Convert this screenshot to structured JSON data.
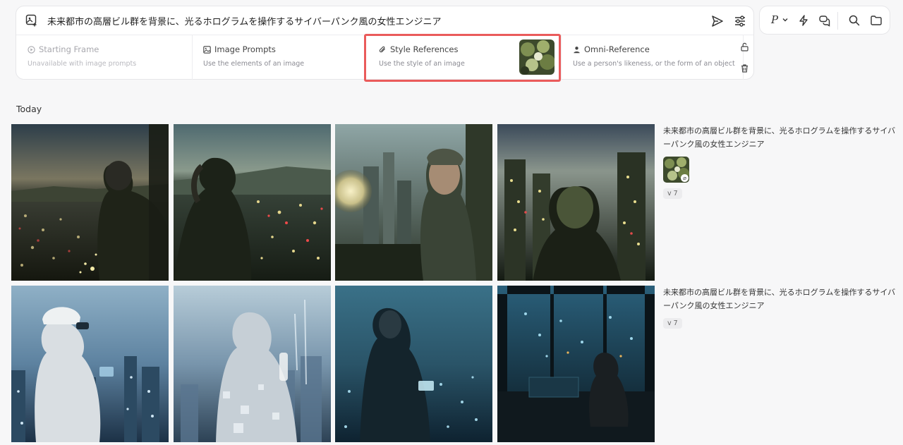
{
  "prompt": {
    "text": "未来都市の高層ビル群を背景に、光るホログラムを操作するサイバーパンク風の女性エンジニア"
  },
  "references": {
    "starting_frame": {
      "title": "Starting Frame",
      "subtitle": "Unavailable with image prompts"
    },
    "image_prompts": {
      "title": "Image Prompts",
      "subtitle": "Use the elements of an image"
    },
    "style_references": {
      "title": "Style References",
      "subtitle": "Use the style of an image"
    },
    "omni_reference": {
      "title": "Omni-Reference",
      "subtitle": "Use a person's likeness, or the form of an object"
    }
  },
  "toolbar": {
    "personalize_label": "P"
  },
  "gallery": {
    "section_title": "Today",
    "jobs": [
      {
        "prompt": "未来都市の高層ビル群を背景に、光るホログラムを操作するサイバーパンク風の女性エンジニア",
        "version": "v 7"
      },
      {
        "prompt": "未来都市の高層ビル群を背景に、光るホログラムを操作するサイバーパンク風の女性エンジニア",
        "version": "v 7"
      }
    ]
  },
  "colors": {
    "highlight": "#ea5b5b",
    "background": "#f7f7f8"
  }
}
